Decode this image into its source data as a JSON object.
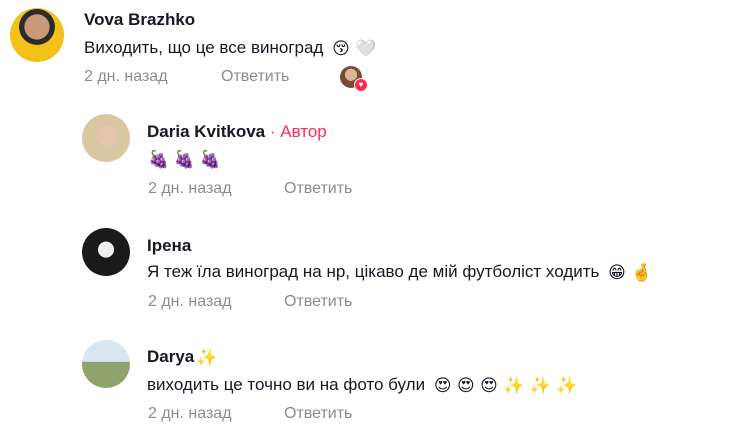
{
  "comments": [
    {
      "name": "Vova Brazhko",
      "text": "Виходить, що це все виноград",
      "emojis": "😚 🤍",
      "time": "2 дн. назад",
      "reply_label": "Ответить"
    },
    {
      "name": "Daria  Kvitkova",
      "author_badge": "· Автор",
      "text": "🍇 🍇 🍇",
      "time": "2 дн. назад",
      "reply_label": "Ответить"
    },
    {
      "name": "Ірена",
      "text": "Я теж їла виноград на нр, цікаво де мій футболіст ходить",
      "emojis": "😁 🤞",
      "time": "2 дн. назад",
      "reply_label": "Ответить"
    },
    {
      "name": "Darya",
      "name_emoji": "✨",
      "text": "виходить це точно ви на фото були",
      "emojis": "😍 😍 😍 ✨ ✨ ✨",
      "time": "2 дн. назад",
      "reply_label": "Ответить"
    }
  ],
  "colors": {
    "author": "#fe2c55",
    "meta": "#8a8b91",
    "text": "#161823"
  },
  "icons": [
    "author-liked-heart-icon"
  ]
}
